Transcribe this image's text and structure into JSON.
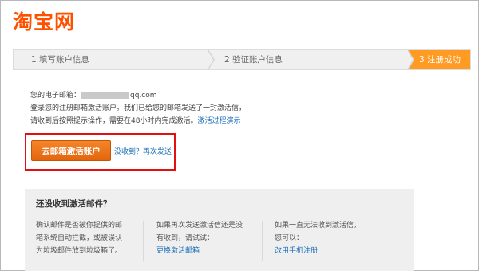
{
  "header": {
    "logo_text": "淘宝网"
  },
  "steps": [
    {
      "label": "1 填写账户信息"
    },
    {
      "label": "2 验证账户信息"
    },
    {
      "label": "3 注册成功"
    }
  ],
  "info": {
    "email_label": "您的电子邮箱：",
    "email_domain": "qq.com",
    "line2": "登录您的注册邮箱激活账户。我们已给您的邮箱发送了一封激活信，",
    "line3": "请收到后按照提示操作，需要在48小时内完成激活。",
    "process_link": "激活过程演示"
  },
  "actions": {
    "activate_button": "去邮箱激活账户",
    "resend_link": "没收到？再次发送"
  },
  "help": {
    "title": "还没收到激活邮件？",
    "col1": {
      "line1": "确认邮件是否被你提供的邮",
      "line2": "箱系统自动拦截，或被误认",
      "line3": "为垃圾邮件放到垃圾箱了。"
    },
    "col2": {
      "line1": "如果再次发送激活信还是没",
      "line2": "有收到，请试试：",
      "link": "更换激活邮箱"
    },
    "col3": {
      "line1": "如果一直无法收到激活信，",
      "line2": "您可以：",
      "link": "改用手机注册"
    }
  },
  "colors": {
    "brand": "#ff5000",
    "step_active": "#ff9a22",
    "button": "#e96e12",
    "highlight": "#e21010",
    "link": "#1b6fb8"
  }
}
